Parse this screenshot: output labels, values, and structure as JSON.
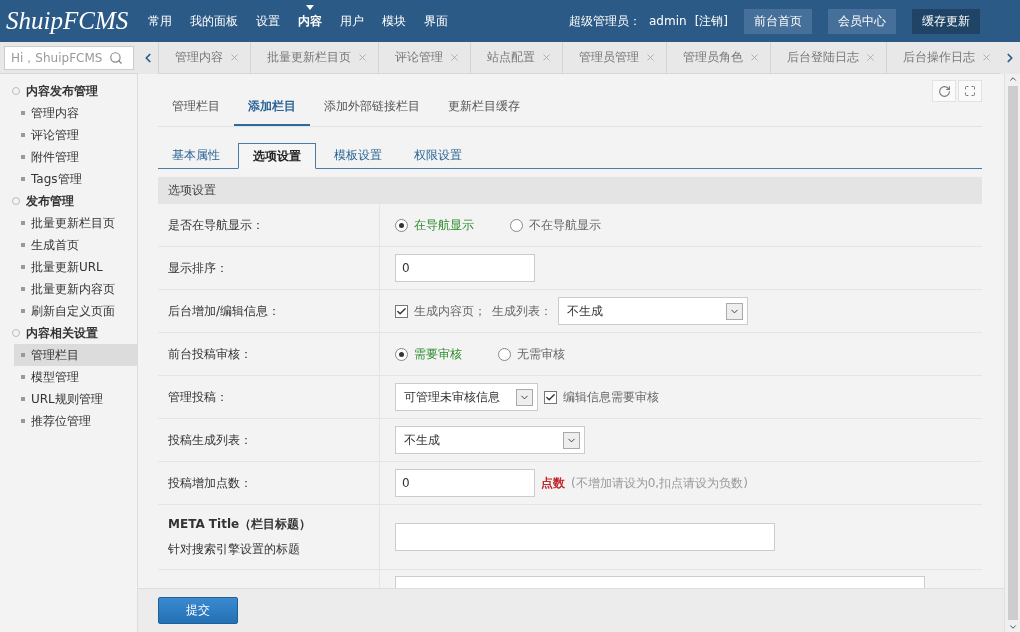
{
  "header": {
    "logo": "ShuipFCMS",
    "nav": [
      {
        "label": "常用",
        "selected": false
      },
      {
        "label": "我的面板",
        "selected": false
      },
      {
        "label": "设置",
        "selected": false
      },
      {
        "label": "内容",
        "selected": true
      },
      {
        "label": "用户",
        "selected": false
      },
      {
        "label": "模块",
        "selected": false
      },
      {
        "label": "界面",
        "selected": false
      }
    ],
    "user_label": "超级管理员：",
    "user": "admin",
    "logout": "[注销]",
    "buttons": [
      {
        "label": "前台首页",
        "emphasis": false
      },
      {
        "label": "会员中心",
        "emphasis": false
      },
      {
        "label": "缓存更新",
        "emphasis": true
      }
    ]
  },
  "search": {
    "placeholder": "Hi，ShuipFCMS"
  },
  "open_tabs": [
    "管理内容",
    "批量更新栏目页",
    "评论管理",
    "站点配置",
    "管理员管理",
    "管理员角色",
    "后台登陆日志",
    "后台操作日志"
  ],
  "sidebar": {
    "groups": [
      {
        "title": "内容发布管理",
        "children": [
          {
            "label": "管理内容",
            "selected": false
          },
          {
            "label": "评论管理",
            "selected": false
          },
          {
            "label": "附件管理",
            "selected": false
          },
          {
            "label": "Tags管理",
            "selected": false
          }
        ]
      },
      {
        "title": "发布管理",
        "children": [
          {
            "label": "批量更新栏目页",
            "selected": false
          },
          {
            "label": "生成首页",
            "selected": false
          },
          {
            "label": "批量更新URL",
            "selected": false
          },
          {
            "label": "批量更新内容页",
            "selected": false
          },
          {
            "label": "刷新自定义页面",
            "selected": false
          }
        ]
      },
      {
        "title": "内容相关设置",
        "children": [
          {
            "label": "管理栏目",
            "selected": true
          },
          {
            "label": "模型管理",
            "selected": false
          },
          {
            "label": "URL规则管理",
            "selected": false
          },
          {
            "label": "推荐位管理",
            "selected": false
          }
        ]
      }
    ]
  },
  "tabs": [
    {
      "label": "管理栏目",
      "selected": false
    },
    {
      "label": "添加栏目",
      "selected": true
    },
    {
      "label": "添加外部链接栏目",
      "selected": false
    },
    {
      "label": "更新栏目缓存",
      "selected": false
    }
  ],
  "sub_tabs": [
    {
      "label": "基本属性",
      "selected": false
    },
    {
      "label": "选项设置",
      "selected": true
    },
    {
      "label": "模板设置",
      "selected": false
    },
    {
      "label": "权限设置",
      "selected": false
    }
  ],
  "section_title": "选项设置",
  "rows": [
    {
      "kind": "radio",
      "label": "是否在导航显示：",
      "options": [
        {
          "label": "在导航显示",
          "selected": true
        },
        {
          "label": "不在导航显示",
          "selected": false
        }
      ]
    },
    {
      "kind": "text",
      "label": "显示排序：",
      "value": "0"
    },
    {
      "kind": "check_select",
      "label": "后台增加/编辑信息：",
      "checkbox": {
        "label": "生成内容页；",
        "checked": true
      },
      "select_label": "生成列表：",
      "select": "不生成"
    },
    {
      "kind": "radio",
      "label": "前台投稿审核：",
      "options": [
        {
          "label": "需要审核",
          "selected": true
        },
        {
          "label": "无需审核",
          "selected": false
        }
      ]
    },
    {
      "kind": "select_check",
      "label": "管理投稿：",
      "select": "可管理未审核信息",
      "checkbox": {
        "label": "编辑信息需要审核",
        "checked": true
      }
    },
    {
      "kind": "select",
      "label": "投稿生成列表：",
      "select": "不生成"
    },
    {
      "kind": "text_note",
      "label": "投稿增加点数：",
      "value": "0",
      "note_strong": "点数",
      "note": "(不增加请设为0,扣点请设为负数)"
    },
    {
      "kind": "wide_text",
      "label": "META Title（栏目标题）",
      "sublabel": "针对搜索引擎设置的标题"
    },
    {
      "kind": "textarea"
    }
  ],
  "submit": "提交"
}
